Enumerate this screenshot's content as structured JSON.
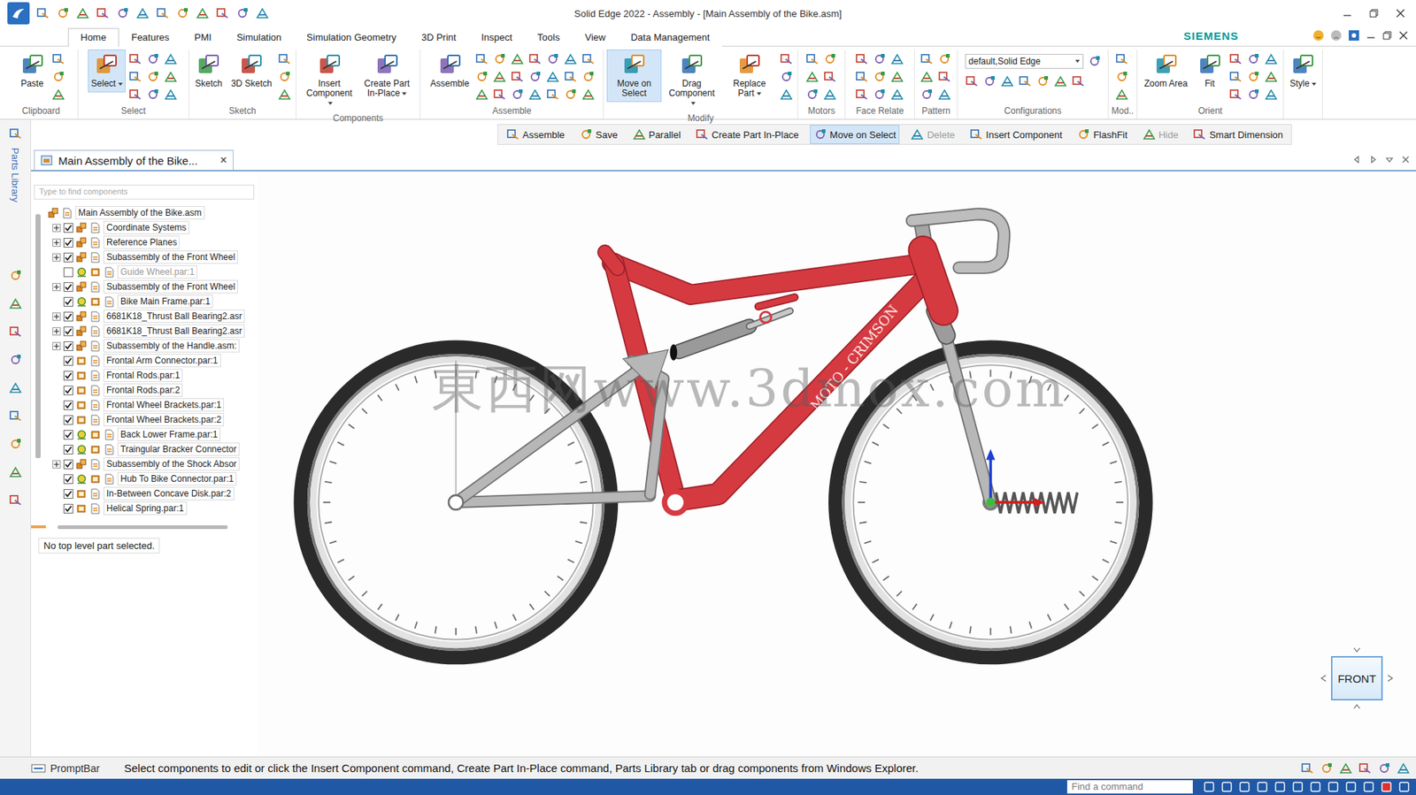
{
  "window": {
    "title": "Solid Edge 2022 - Assembly - [Main Assembly of the Bike.asm]",
    "brand": "SIEMENS"
  },
  "ribbon_tabs": [
    {
      "label": "Home",
      "selected": true
    },
    {
      "label": "Features",
      "selected": false
    },
    {
      "label": "PMI",
      "selected": false
    },
    {
      "label": "Simulation",
      "selected": false
    },
    {
      "label": "Simulation Geometry",
      "selected": false
    },
    {
      "label": "3D Print",
      "selected": false
    },
    {
      "label": "Inspect",
      "selected": false
    },
    {
      "label": "Tools",
      "selected": false
    },
    {
      "label": "View",
      "selected": false
    },
    {
      "label": "Data Management",
      "selected": false
    }
  ],
  "ribbon_groups": [
    {
      "label": "Clipboard",
      "buttons": [
        {
          "label": "Paste",
          "selected": false,
          "dropdown": false
        }
      ]
    },
    {
      "label": "Select",
      "buttons": [
        {
          "label": "Select",
          "selected": true,
          "dropdown": true
        }
      ]
    },
    {
      "label": "Sketch",
      "buttons": [
        {
          "label": "Sketch",
          "selected": false,
          "dropdown": false
        },
        {
          "label": "3D Sketch",
          "selected": false,
          "dropdown": false
        }
      ]
    },
    {
      "label": "Components",
      "buttons": [
        {
          "label": "Insert Component",
          "selected": false,
          "dropdown": true
        },
        {
          "label": "Create Part In-Place",
          "selected": false,
          "dropdown": true
        }
      ]
    },
    {
      "label": "Assemble",
      "buttons": [
        {
          "label": "Assemble",
          "selected": false,
          "dropdown": false
        }
      ]
    },
    {
      "label": "Modify",
      "buttons": [
        {
          "label": "Move on Select",
          "selected": true,
          "dropdown": false
        },
        {
          "label": "Drag Component",
          "selected": false,
          "dropdown": true
        },
        {
          "label": "Replace Part",
          "selected": false,
          "dropdown": true
        }
      ]
    },
    {
      "label": "Motors",
      "buttons": []
    },
    {
      "label": "Face Relate",
      "buttons": []
    },
    {
      "label": "Pattern",
      "buttons": []
    },
    {
      "label": "Configurations",
      "buttons": [],
      "field": "default,Solid Edge"
    },
    {
      "label": "Mod..",
      "buttons": []
    },
    {
      "label": "Orient",
      "buttons": [
        {
          "label": "Zoom Area",
          "selected": false,
          "dropdown": false
        },
        {
          "label": "Fit",
          "selected": false,
          "dropdown": false
        }
      ]
    },
    {
      "buttons": [
        {
          "label": "Style",
          "selected": false,
          "dropdown": true
        }
      ]
    }
  ],
  "command_bar": [
    {
      "label": "Assemble",
      "selected": false,
      "disabled": false
    },
    {
      "label": "Save",
      "selected": false,
      "disabled": false
    },
    {
      "label": "Parallel",
      "selected": false,
      "disabled": false
    },
    {
      "label": "Create Part In-Place",
      "selected": false,
      "disabled": false
    },
    {
      "label": "Move on Select",
      "selected": true,
      "disabled": false
    },
    {
      "label": "Delete",
      "selected": false,
      "disabled": true
    },
    {
      "label": "Insert Component",
      "selected": false,
      "disabled": false
    },
    {
      "label": "FlashFit",
      "selected": false,
      "disabled": false
    },
    {
      "label": "Hide",
      "selected": false,
      "disabled": true
    },
    {
      "label": "Smart Dimension",
      "selected": false,
      "disabled": false
    }
  ],
  "document_tab": {
    "label": "Main Assembly of the Bike...",
    "close": "×"
  },
  "side_strip": {
    "label": "Parts Library"
  },
  "tree": {
    "search_placeholder": "Type to find components",
    "root": "Main Assembly of the Bike.asm",
    "items": [
      {
        "label": "Coordinate Systems",
        "expandable": true,
        "checked": true,
        "greyed": false,
        "grounded": false
      },
      {
        "label": "Reference Planes",
        "expandable": true,
        "checked": true,
        "greyed": false,
        "grounded": false
      },
      {
        "label": "Subassembly of the Front Wheel",
        "expandable": true,
        "checked": true,
        "greyed": false,
        "grounded": false
      },
      {
        "label": "Guide Wheel.par:1",
        "expandable": false,
        "checked": false,
        "greyed": true,
        "grounded": true
      },
      {
        "label": "Subassembly of the Front Wheel",
        "expandable": true,
        "checked": true,
        "greyed": false,
        "grounded": false
      },
      {
        "label": "Bike Main Frame.par:1",
        "expandable": false,
        "checked": true,
        "greyed": false,
        "grounded": true
      },
      {
        "label": "6681K18_Thrust Ball Bearing2.asr",
        "expandable": true,
        "checked": true,
        "greyed": false,
        "grounded": false
      },
      {
        "label": "6681K18_Thrust Ball Bearing2.asr",
        "expandable": true,
        "checked": true,
        "greyed": false,
        "grounded": false
      },
      {
        "label": "Subassembly of the Handle.asm:",
        "expandable": true,
        "checked": true,
        "greyed": false,
        "grounded": false
      },
      {
        "label": "Frontal Arm Connector.par:1",
        "expandable": false,
        "checked": true,
        "greyed": false,
        "grounded": false
      },
      {
        "label": "Frontal Rods.par:1",
        "expandable": false,
        "checked": true,
        "greyed": false,
        "grounded": false
      },
      {
        "label": "Frontal Rods.par:2",
        "expandable": false,
        "checked": true,
        "greyed": false,
        "grounded": false
      },
      {
        "label": "Frontal Wheel Brackets.par:1",
        "expandable": false,
        "checked": true,
        "greyed": false,
        "grounded": false
      },
      {
        "label": "Frontal Wheel Brackets.par:2",
        "expandable": false,
        "checked": true,
        "greyed": false,
        "grounded": false
      },
      {
        "label": "Back Lower Frame.par:1",
        "expandable": false,
        "checked": true,
        "greyed": false,
        "grounded": true
      },
      {
        "label": "Traingular Bracker Connector",
        "expandable": false,
        "checked": true,
        "greyed": false,
        "grounded": true
      },
      {
        "label": "Subassembly of the Shock Absor",
        "expandable": true,
        "checked": true,
        "greyed": false,
        "grounded": false
      },
      {
        "label": "Hub To Bike Connector.par:1",
        "expandable": false,
        "checked": true,
        "greyed": false,
        "grounded": true
      },
      {
        "label": "In-Between Concave Disk.par:2",
        "expandable": false,
        "checked": true,
        "greyed": false,
        "grounded": false
      },
      {
        "label": "Helical Spring.par:1",
        "expandable": false,
        "checked": true,
        "greyed": false,
        "grounded": false
      }
    ]
  },
  "tree_status": "No top level part selected.",
  "viewport": {
    "watermark": "東西网www.3dmox.com",
    "decal": "MOTO - CRIMSON",
    "view_cube": "FRONT"
  },
  "prompt_bar": {
    "label": "PromptBar",
    "message": "Select components to edit or click the Insert Component command, Create Part In-Place command, Parts Library tab or drag components from Windows Explorer."
  },
  "status_bar": {
    "search_placeholder": "Find a command"
  }
}
